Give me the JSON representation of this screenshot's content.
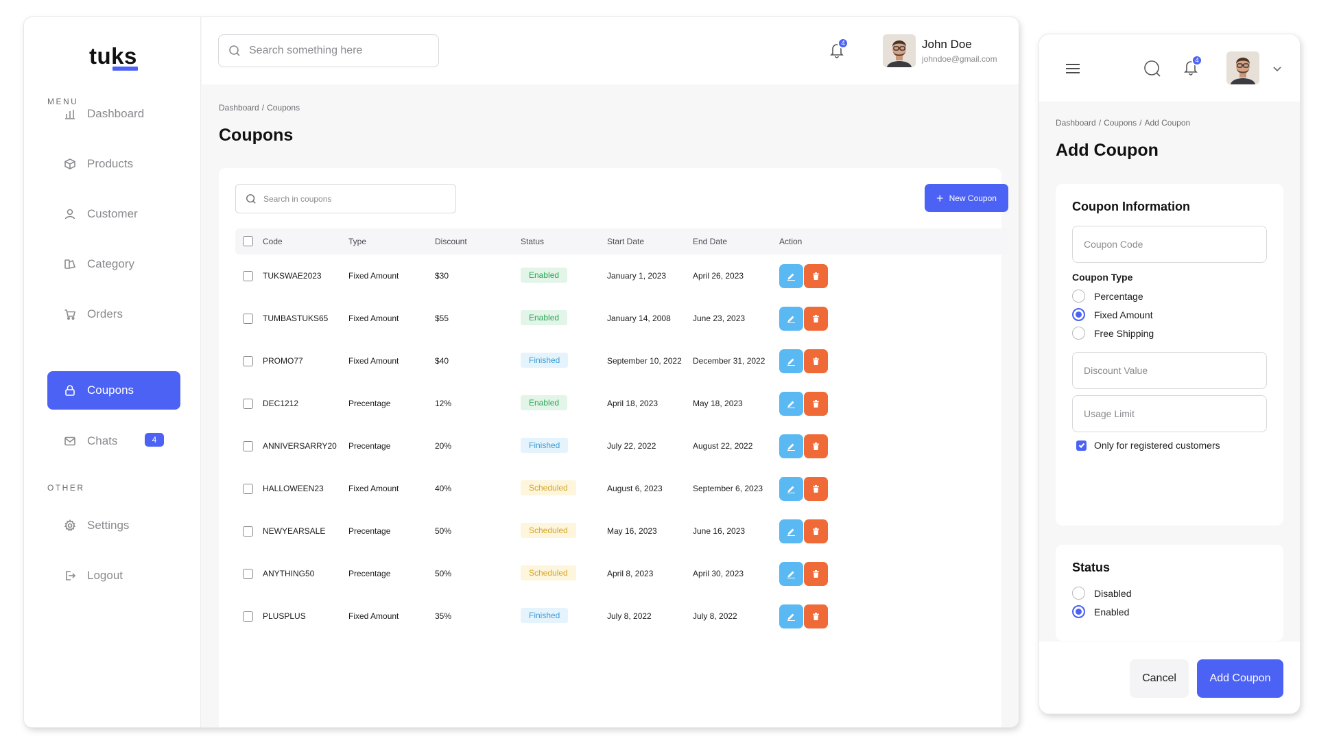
{
  "brand": {
    "name": "tuks",
    "accent": "#4b62f5"
  },
  "sidebar": {
    "menu_label": "MENU",
    "other_label": "OTHER",
    "items": [
      {
        "label": "Dashboard",
        "icon": "bar-chart-icon"
      },
      {
        "label": "Products",
        "icon": "box-icon"
      },
      {
        "label": "Customer",
        "icon": "user-icon"
      },
      {
        "label": "Category",
        "icon": "category-icon"
      },
      {
        "label": "Orders",
        "icon": "cart-icon"
      },
      {
        "label": "Coupons",
        "icon": "lock-icon",
        "active": true
      },
      {
        "label": "Chats",
        "icon": "mail-icon",
        "badge": "4"
      }
    ],
    "other_items": [
      {
        "label": "Settings",
        "icon": "gear-icon"
      },
      {
        "label": "Logout",
        "icon": "logout-icon"
      }
    ]
  },
  "topbar": {
    "search_placeholder": "Search something here",
    "notification_count": "4",
    "user": {
      "name": "John Doe",
      "email": "johndoe@gmail.com"
    }
  },
  "main": {
    "breadcrumb": [
      "Dashboard",
      "Coupons"
    ],
    "title": "Coupons",
    "search_placeholder": "Search in coupons",
    "new_button": "New Coupon",
    "columns": [
      "Code",
      "Type",
      "Discount",
      "Status",
      "Start Date",
      "End Date",
      "Action"
    ],
    "rows": [
      {
        "code": "TUKSWAE2023",
        "type": "Fixed Amount",
        "discount": "$30",
        "status": "Enabled",
        "start": "January 1, 2023",
        "end": "April 26, 2023"
      },
      {
        "code": "TUMBASTUKS65",
        "type": "Fixed Amount",
        "discount": "$55",
        "status": "Enabled",
        "start": "January 14, 2008",
        "end": "June 23, 2023"
      },
      {
        "code": "PROMO77",
        "type": "Fixed Amount",
        "discount": "$40",
        "status": "Finished",
        "start": "September 10, 2022",
        "end": "December 31, 2022"
      },
      {
        "code": "DEC1212",
        "type": "Precentage",
        "discount": "12%",
        "status": "Enabled",
        "start": "April 18, 2023",
        "end": "May 18, 2023"
      },
      {
        "code": "ANNIVERSARRY20",
        "type": "Precentage",
        "discount": "20%",
        "status": "Finished",
        "start": "July 22, 2022",
        "end": "August 22, 2022"
      },
      {
        "code": "HALLOWEEN23",
        "type": "Fixed Amount",
        "discount": "40%",
        "status": "Scheduled",
        "start": "August 6, 2023",
        "end": "September 6, 2023"
      },
      {
        "code": "NEWYEARSALE",
        "type": "Precentage",
        "discount": "50%",
        "status": "Scheduled",
        "start": "May 16, 2023",
        "end": "June 16, 2023"
      },
      {
        "code": "ANYTHING50",
        "type": "Precentage",
        "discount": "50%",
        "status": "Scheduled",
        "start": "April 8, 2023",
        "end": "April 30, 2023"
      },
      {
        "code": "PLUSPLUS",
        "type": "Fixed Amount",
        "discount": "35%",
        "status": "Finished",
        "start": "July 8, 2022",
        "end": "July 8, 2022"
      }
    ]
  },
  "panel": {
    "notification_count": "4",
    "breadcrumb": [
      "Dashboard",
      "Coupons",
      "Add Coupon"
    ],
    "title": "Add Coupon",
    "info_heading": "Coupon Information",
    "code_placeholder": "Coupon Code",
    "type_label": "Coupon Type",
    "type_options": [
      {
        "label": "Percentage",
        "selected": false
      },
      {
        "label": "Fixed Amount",
        "selected": true
      },
      {
        "label": "Free Shipping",
        "selected": false
      }
    ],
    "discount_placeholder": "Discount Value",
    "usage_placeholder": "Usage Limit",
    "registered_only_label": "Only for registered customers",
    "registered_only_checked": true,
    "status_heading": "Status",
    "status_options": [
      {
        "label": "Disabled",
        "selected": false
      },
      {
        "label": "Enabled",
        "selected": true
      }
    ],
    "cancel_label": "Cancel",
    "add_label": "Add Coupon"
  },
  "status_colors": {
    "Enabled": "#28a554",
    "Finished": "#3a9bd8",
    "Scheduled": "#d4a628"
  }
}
